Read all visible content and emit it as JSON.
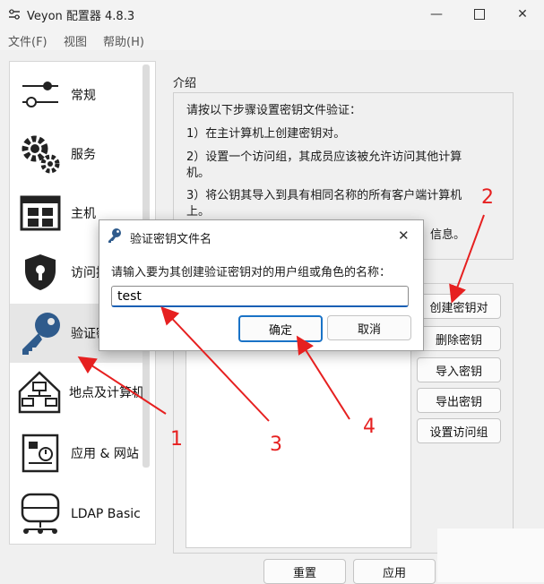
{
  "window": {
    "title": "Veyon 配置器 4.8.3",
    "controls": [
      "minimize-icon",
      "maximize-icon",
      "close-icon"
    ]
  },
  "menu": [
    "文件(F)",
    "视图",
    "帮助(H)"
  ],
  "sidebar": {
    "items": [
      {
        "label": "常规",
        "icon": "sliders-icon"
      },
      {
        "label": "服务",
        "icon": "gears-icon"
      },
      {
        "label": "主机",
        "icon": "grid-icon"
      },
      {
        "label": "访问控",
        "icon": "shield-lock-icon"
      },
      {
        "label": "验证密",
        "icon": "key-icon"
      },
      {
        "label": "地点及计算机",
        "icon": "network-house-icon"
      },
      {
        "label": "应用 & 网站",
        "icon": "apps-icon"
      },
      {
        "label": "LDAP Basic",
        "icon": "database-icon"
      }
    ],
    "selected_index": 4
  },
  "intro": {
    "heading": "介绍",
    "lines": [
      "请按以下步骤设置密钥文件验证：",
      "1）在主计算机上创建密钥对。",
      "2）设置一个访问组，其成员应该被允许访问其他计算",
      "机。",
      "3）将公钥其导入到具有相同名称的所有客户端计算机",
      "上。",
      "信息。"
    ]
  },
  "key_buttons": [
    "创建密钥对",
    "删除密钥",
    "导入密钥",
    "导出密钥",
    "设置访问组"
  ],
  "bottom_buttons": {
    "reset": "重置",
    "apply": "应用"
  },
  "dialog": {
    "title": "验证密钥文件名",
    "prompt": "请输入要为其创建验证密钥对的用户组或角色的名称：",
    "input_value": "test",
    "ok": "确定",
    "cancel": "取消"
  },
  "annotations": [
    "1",
    "2",
    "3",
    "4"
  ],
  "colors": {
    "annotation": "#e62020",
    "accent": "#1a73c7",
    "key_icon": "#2f5b8c"
  }
}
